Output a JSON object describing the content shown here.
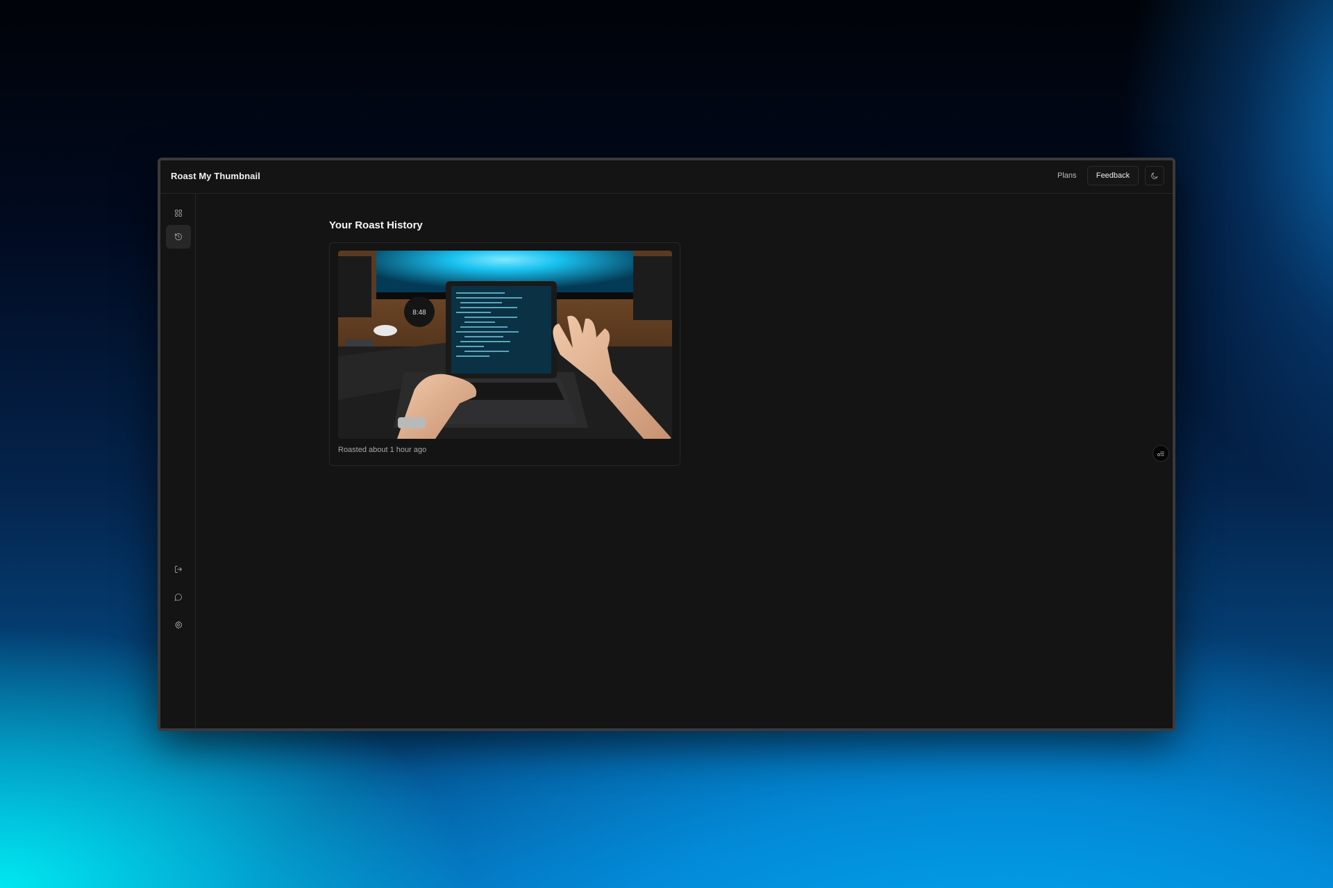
{
  "header": {
    "app_title": "Roast My Thumbnail",
    "plans_label": "Plans",
    "feedback_label": "Feedback",
    "theme_icon": "moon-icon"
  },
  "sidebar": {
    "top_items": [
      {
        "icon": "dashboard-grid-icon",
        "active": false
      },
      {
        "icon": "history-icon",
        "active": true
      }
    ],
    "bottom_items": [
      {
        "icon": "logout-icon"
      },
      {
        "icon": "chat-bubble-icon"
      },
      {
        "icon": "settings-gear-icon"
      }
    ]
  },
  "main": {
    "title": "Your Roast History",
    "items": [
      {
        "thumbnail_alt": "Hands typing on a laptop with code on screen at a desk with monitors",
        "clock_text": "8:48",
        "meta": "Roasted about 1 hour ago"
      }
    ]
  },
  "floating_button": {
    "icon": "settings-list-icon"
  },
  "colors": {
    "window_bg": "#141414",
    "border": "#262626",
    "text_primary": "#f2f2f2",
    "text_muted": "#a8a8a8",
    "accent_glow": "#19c2f0"
  }
}
